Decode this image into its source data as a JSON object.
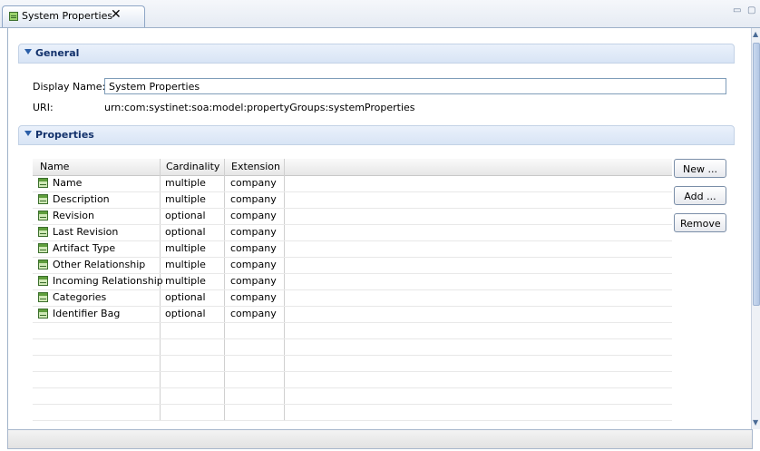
{
  "tab": {
    "title": "System Properties",
    "close_glyph": "✕"
  },
  "window_controls": {
    "minimize": "▭",
    "maximize": "▢"
  },
  "general": {
    "section_title": "General",
    "display_name_label": "Display Name:",
    "display_name_value": "System Properties",
    "uri_label": "URI:",
    "uri_value": "urn:com:systinet:soa:model:propertyGroups:systemProperties"
  },
  "properties": {
    "section_title": "Properties",
    "columns": [
      "Name",
      "Cardinality",
      "Extension"
    ],
    "rows": [
      {
        "name": "Name",
        "cardinality": "multiple",
        "extension": "company"
      },
      {
        "name": "Description",
        "cardinality": "multiple",
        "extension": "company"
      },
      {
        "name": "Revision",
        "cardinality": "optional",
        "extension": "company"
      },
      {
        "name": "Last Revision",
        "cardinality": "optional",
        "extension": "company"
      },
      {
        "name": "Artifact Type",
        "cardinality": "multiple",
        "extension": "company"
      },
      {
        "name": "Other Relationship",
        "cardinality": "multiple",
        "extension": "company"
      },
      {
        "name": "Incoming Relationship",
        "cardinality": "multiple",
        "extension": "company"
      },
      {
        "name": "Categories",
        "cardinality": "optional",
        "extension": "company"
      },
      {
        "name": "Identifier Bag",
        "cardinality": "optional",
        "extension": "company"
      }
    ],
    "buttons": {
      "new": "New ...",
      "add": "Add ...",
      "remove": "Remove"
    }
  },
  "icons": {
    "tab": "property-group-icon",
    "row": "property-icon",
    "section_toggle": "expanded-triangle-icon"
  },
  "colors": {
    "section_title": "#12316b",
    "toggle": "#2a5ea8",
    "icon_green": "#5f9e3c"
  }
}
